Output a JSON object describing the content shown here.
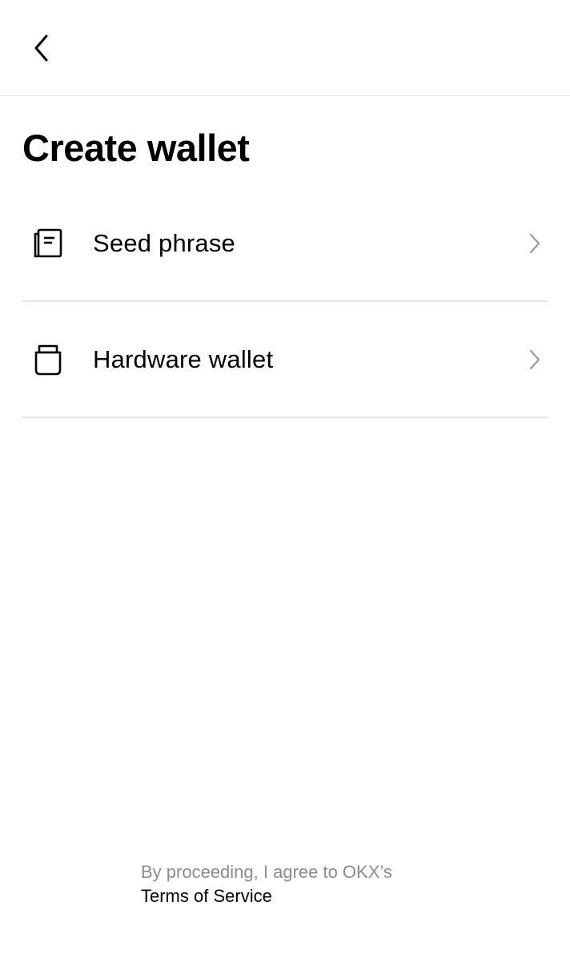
{
  "header": {
    "back_icon": "chevron-left-icon"
  },
  "page": {
    "title": "Create wallet"
  },
  "options": [
    {
      "label": "Seed phrase",
      "icon": "seed-phrase-book-icon"
    },
    {
      "label": "Hardware wallet",
      "icon": "hardware-wallet-icon"
    }
  ],
  "footer": {
    "agree_text": "By proceeding, I agree to OKX’s",
    "terms_link": "Terms of Service"
  },
  "colors": {
    "text": "#000000",
    "muted": "#8c8c8c",
    "divider": "#e4e4e4",
    "chevron": "#9a9a9a"
  }
}
